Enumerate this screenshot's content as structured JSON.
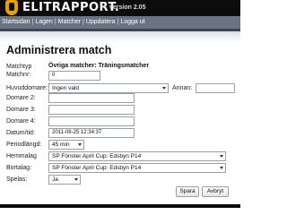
{
  "header": {
    "logo_text": "ELITRAPPORT.",
    "version": "version 2.05"
  },
  "nav": {
    "items": [
      "Startsidan",
      "Lagen",
      "Matcher",
      "Uppdatera",
      "Logga ut"
    ],
    "separator": "|"
  },
  "page": {
    "title": "Administrera match"
  },
  "form": {
    "matchtyp": {
      "label": "Matchtyp",
      "value": "Övriga matcher: Träningsmatcher"
    },
    "matchnr": {
      "label": "Matchnr:",
      "value": "0"
    },
    "huvuddomare": {
      "label": "Huvuddomare:",
      "selected": "Ingen vald"
    },
    "annan": {
      "label": "Annan:",
      "value": ""
    },
    "domare2": {
      "label": "Domare 2:",
      "value": ""
    },
    "domare3": {
      "label": "Domare 3:",
      "value": ""
    },
    "domare4": {
      "label": "Domare 4:",
      "value": ""
    },
    "datum": {
      "label": "Datum/tid:",
      "value": "2011-08-25 12:34:37"
    },
    "periodlangd": {
      "label": "Periodlängd:",
      "selected": "45 min"
    },
    "hemmalag": {
      "label": "Hemmalag",
      "selected": "SP Fönster April Cup: Edsbyn P14"
    },
    "bortalag": {
      "label": "Bortalag:",
      "selected": "SP Fönster April Cup: Edsbyn P14"
    },
    "spelas": {
      "label": "Spelas:",
      "selected": "Ja"
    }
  },
  "buttons": {
    "save": "Spara",
    "cancel": "Avbryt"
  }
}
